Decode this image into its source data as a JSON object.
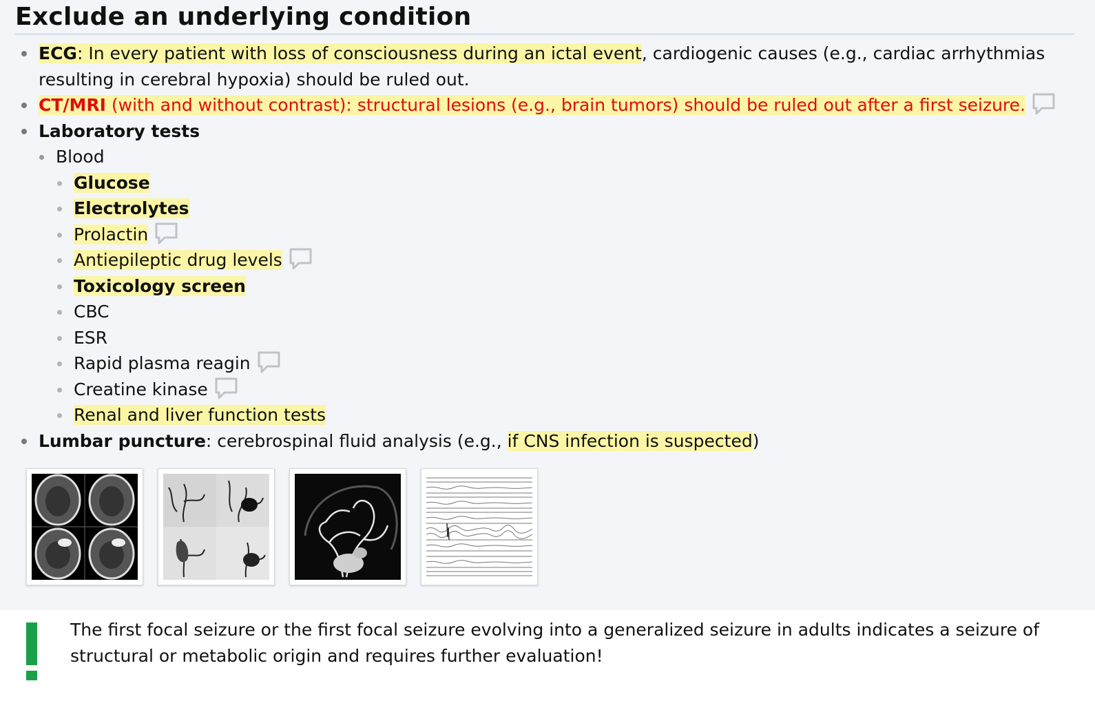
{
  "section": {
    "title": "Exclude an underlying condition"
  },
  "items": {
    "ecg": {
      "label": "ECG",
      "highlight_text": ": In every patient with loss of consciousness during an ictal event",
      "rest_text": ", cardiogenic causes (e.g., cardiac arrhythmias resulting in cerebral hypoxia) should be ruled out."
    },
    "ctmri": {
      "label": "CT/MRI",
      "text": " (with and without contrast): structural lesions (e.g., brain tumors) should be ruled out after a first seizure."
    },
    "lab": {
      "label": "Laboratory tests",
      "blood": {
        "label": "Blood",
        "tests": [
          "Glucose",
          "Electrolytes",
          "Prolactin",
          "Antiepileptic drug levels",
          "Toxicology screen",
          "CBC",
          "ESR",
          "Rapid plasma reagin",
          "Creatine kinase",
          "Renal and liver function tests"
        ]
      }
    },
    "lumbar": {
      "label": "Lumbar puncture",
      "text": ": cerebrospinal fluid analysis (e.g., ",
      "highlight_text": "if CNS infection is suspected",
      "end_text": ")"
    }
  },
  "images": [
    {
      "icon": "ct-scan-thumbnail"
    },
    {
      "icon": "angiography-thumbnail"
    },
    {
      "icon": "cerebral-angiogram-thumbnail"
    },
    {
      "icon": "eeg-trace-thumbnail"
    }
  ],
  "note": {
    "icon": "exclamation-icon",
    "text": "The first focal seizure or the first focal seizure evolving into a generalized seizure in adults indicates a seizure of structural or metabolic origin and requires further evaluation!"
  },
  "colors": {
    "highlight": "#fbf6a6",
    "red": "#e10d0d",
    "exclamation": "#1aa04a"
  }
}
